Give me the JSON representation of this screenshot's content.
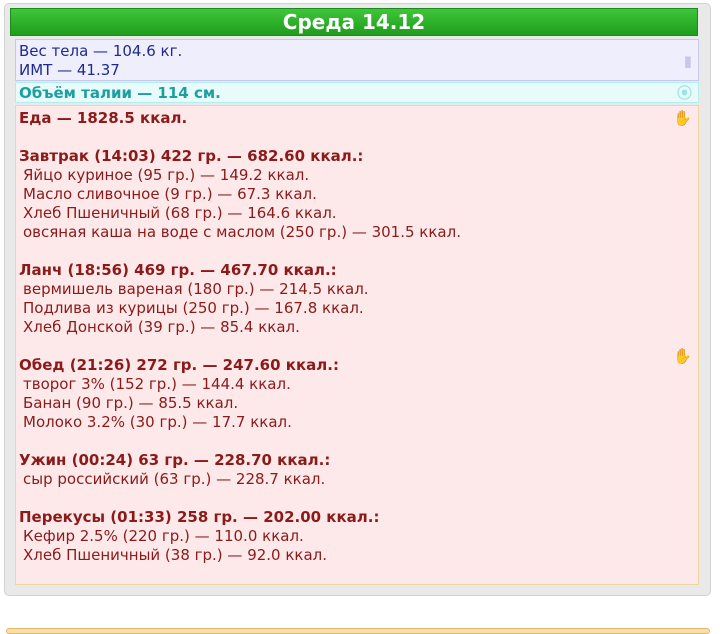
{
  "header": {
    "title": "Среда 14.12"
  },
  "weight": {
    "line1": "Вес тела — 104.6 кг.",
    "line2": "ИМТ — 41.37",
    "icon": "scale-icon"
  },
  "waist": {
    "text": "Объём талии — 114 см.",
    "icon": "tape-icon"
  },
  "food": {
    "total": "Еда — 1828.5 ккал.",
    "icon": "hand-icon",
    "meals": [
      {
        "title": "Завтрак (14:03) 422 гр. — 682.60 ккал.:",
        "items": [
          "Яйцо куриное (95 гр.) — 149.2 ккал.",
          "Масло сливочное (9 гр.) — 67.3 ккал.",
          "Хлеб Пшеничный (68 гр.) — 164.6 ккал.",
          "овсяная каша на воде с маслом (250 гр.) — 301.5 ккал."
        ]
      },
      {
        "title": "Ланч (18:56) 469 гр. — 467.70 ккал.:",
        "items": [
          "вермишель вареная (180 гр.) — 214.5 ккал.",
          "Подлива из курицы (250 гр.) — 167.8 ккал.",
          "Хлеб Донской (39 гр.) — 85.4 ккал."
        ]
      },
      {
        "title": "Обед (21:26) 272 гр. — 247.60 ккал.:",
        "items": [
          "творог 3% (152 гр.) — 144.4 ккал.",
          "Банан (90 гр.) — 85.5 ккал.",
          "Молоко 3.2% (30 гр.) — 17.7 ккал."
        ]
      },
      {
        "title": "Ужин (00:24) 63 гр. — 228.70 ккал.:",
        "items": [
          "сыр российский (63 гр.) — 228.7 ккал."
        ]
      },
      {
        "title": "Перекусы (01:33) 258 гр. — 202.00 ккал.:",
        "items": [
          "Кефир 2.5% (220 гр.) — 110.0 ккал.",
          "Хлеб Пшеничный (38 гр.) — 92.0 ккал."
        ]
      }
    ]
  }
}
